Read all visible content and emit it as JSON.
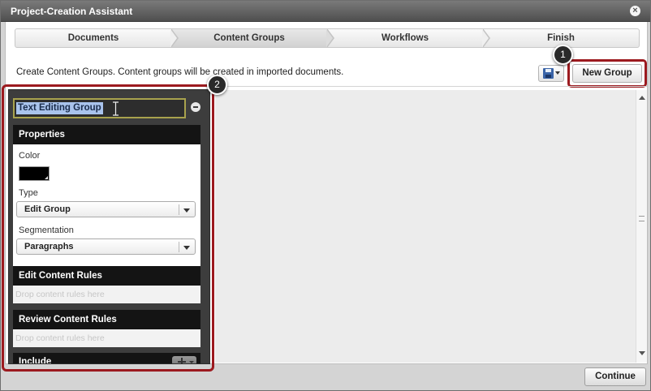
{
  "window": {
    "title": "Project-Creation Assistant"
  },
  "steps": [
    {
      "label": "Documents"
    },
    {
      "label": "Content Groups"
    },
    {
      "label": "Workflows"
    },
    {
      "label": "Finish"
    }
  ],
  "description": "Create Content Groups. Content groups will be created in imported documents.",
  "toolbar": {
    "new_group_label": "New Group"
  },
  "callouts": {
    "first": "1",
    "second": "2"
  },
  "group": {
    "name": "Text Editing Group",
    "properties": {
      "heading": "Properties",
      "color_label": "Color",
      "color_value": "#000000",
      "type_label": "Type",
      "type_value": "Edit Group",
      "segmentation_label": "Segmentation",
      "segmentation_value": "Paragraphs"
    },
    "edit_rules": {
      "heading": "Edit Content Rules",
      "placeholder": "Drop content rules here"
    },
    "review_rules": {
      "heading": "Review Content Rules",
      "placeholder": "Drop content rules here"
    },
    "include": {
      "heading": "Include"
    }
  },
  "footer": {
    "continue_label": "Continue"
  },
  "colors": {
    "highlight": "#9c1a1f",
    "selection": "#a9c3ec"
  }
}
